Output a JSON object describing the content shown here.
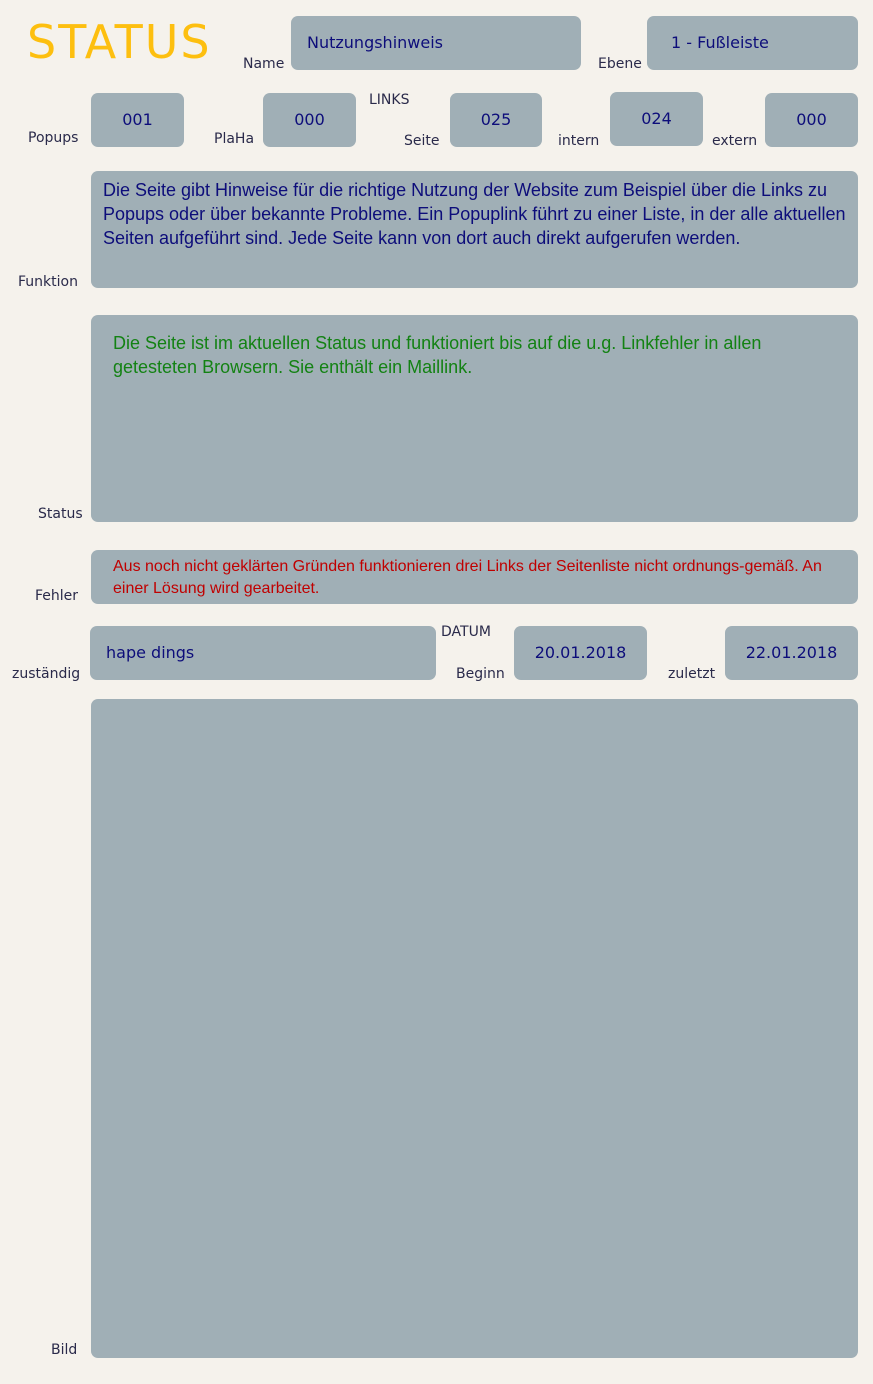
{
  "title": "STATUS",
  "colors": {
    "title": "#fdbf0f",
    "field_bg": "#a0afb6",
    "value_text": "#0d0d7a",
    "status_text": "#138213",
    "error_text": "#c00000",
    "label_text": "#2a2a4a",
    "background": "#f5f2ec"
  },
  "name": {
    "label": "Name",
    "value": "Nutzungshinweis"
  },
  "ebene": {
    "label": "Ebene",
    "value": "1 - Fußleiste"
  },
  "popups": {
    "label": "Popups",
    "value": "001"
  },
  "plaha": {
    "label": "PlaHa",
    "value": "000"
  },
  "links": {
    "heading": "LINKS",
    "seite": {
      "label": "Seite",
      "value": "025"
    },
    "intern": {
      "label": "intern",
      "value": "024"
    },
    "extern": {
      "label": "extern",
      "value": "000"
    }
  },
  "funktion": {
    "label": "Funktion",
    "text": "Die Seite gibt Hinweise für die richtige Nutzung der Website zum Beispiel über die Links zu Popups oder über bekannte Probleme. Ein Popuplink führt zu einer Liste, in der alle aktuellen Seiten aufgeführt sind. Jede Seite kann von dort auch direkt aufgerufen werden."
  },
  "status": {
    "label": "Status",
    "text": "Die Seite ist im aktuellen Status und funktioniert bis auf die u.g. Linkfehler in allen getesteten Browsern. Sie enthält ein Maillink."
  },
  "fehler": {
    "label": "Fehler",
    "text": "Aus noch nicht geklärten Gründen funktionieren drei Links der Seitenliste nicht ordnungs-gemäß. An einer Lösung wird gearbeitet."
  },
  "zustaendig": {
    "label": "zuständig",
    "value": "hape dings"
  },
  "datum": {
    "heading": "DATUM",
    "beginn": {
      "label": "Beginn",
      "value": "20.01.2018"
    },
    "zuletzt": {
      "label": "zuletzt",
      "value": "22.01.2018"
    }
  },
  "bild": {
    "label": "Bild"
  }
}
